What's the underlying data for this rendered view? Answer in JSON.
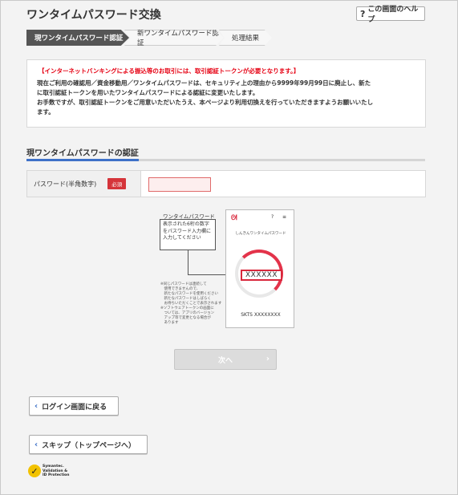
{
  "page": {
    "title": "ワンタイムパスワード交換",
    "help_label": "この画面のヘルプ"
  },
  "steps": [
    {
      "label": "現ワンタイムパスワード認証",
      "active": true
    },
    {
      "label": "新ワンタイムパスワード認証",
      "active": false
    },
    {
      "label": "処理結果",
      "active": false
    }
  ],
  "notice": {
    "heading": "【インターネットバンキングによる振込等のお取引には、取引認証トークンが必要となります。】",
    "lines": [
      "現在ご利用の確認用／資金移動用／ワンタイムパスワードは、セキュリティ上の理由から9999年99月99日に廃止し、新た",
      "に取引認証トークンを用いたワンタイムパスワードによる認証に変更いたします。",
      "お手数ですが、取引認証トークンをご用意いただいたうえ、本ページより利用切換えを行っていただきますようお願いいたし",
      "ます。"
    ]
  },
  "section": {
    "title": "現ワンタイムパスワードの認証"
  },
  "form": {
    "password_label": "パスワード(半角数字)",
    "required_badge": "必須",
    "password_value": ""
  },
  "diagram": {
    "label": "ワンタイムパスワード",
    "box_lines": [
      "表示された6桁の数字",
      "をパスワード入力欄に",
      "入力してください"
    ],
    "note_lines": [
      "※同じパスワードは連続して",
      "　使用できませんので、",
      "　新たなパスワードを使用ください",
      "　新たなパスワードはしばらく",
      "　お待ちいただくことで表示されます",
      "※ソフトウェアトークンの画面に",
      "　ついては、アプリのバージョン",
      "　アップ等で変更となる場合が",
      "　あります"
    ],
    "phone_logo": "ᘛ",
    "phone_help": "?",
    "phone_menu": "≡",
    "phone_app_name": "しんきんワンタイムパスワード",
    "code": "XXXXXX",
    "serial": "SKTS XXXXXXXX"
  },
  "buttons": {
    "next": "次へ",
    "back_login": "ログイン画面に戻る",
    "skip": "スキップ（トップページへ）"
  },
  "badge": {
    "lines": [
      "Symantec.",
      "Validation &",
      "ID Protection"
    ]
  },
  "colors": {
    "accent_blue": "#3e71c8",
    "alert_red": "#e60012",
    "required_red": "#d5343a"
  }
}
